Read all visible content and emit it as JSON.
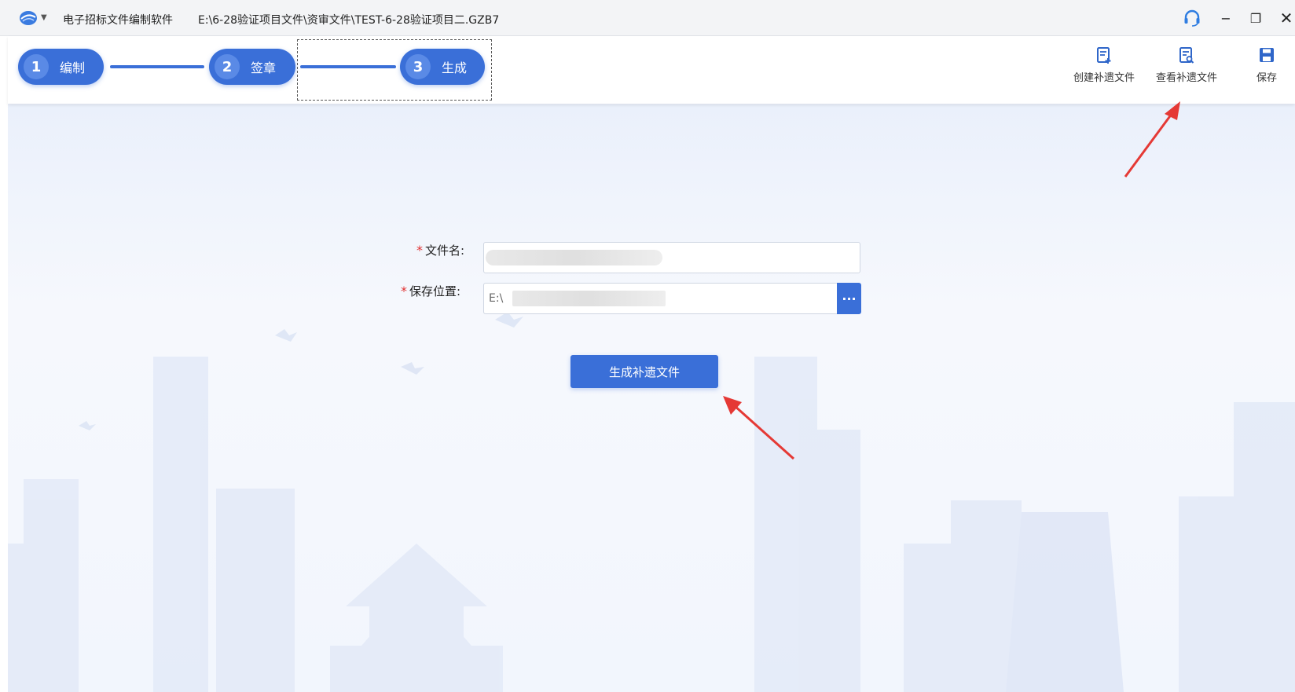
{
  "titlebar": {
    "app_name": "电子招标文件编制软件",
    "file_path": "E:\\6-28验证项目文件\\资审文件\\TEST-6-28验证项目二.GZB7",
    "minimize_glyph": "−",
    "restore_glyph": "❐",
    "close_glyph": "✕"
  },
  "steps": [
    {
      "number": "1",
      "label": "编制"
    },
    {
      "number": "2",
      "label": "签章"
    },
    {
      "number": "3",
      "label": "生成"
    }
  ],
  "toolbar": {
    "create_label": "创建补遗文件",
    "view_label": "查看补遗文件",
    "save_label": "保存"
  },
  "form": {
    "required_mark": "*",
    "file_name_label": "文件名:",
    "save_location_label": "保存位置:",
    "save_location_value": "E:\\",
    "browse_label": "···",
    "generate_button": "生成补遗文件"
  },
  "colors": {
    "accent": "#3a6fd8",
    "required": "#e03131",
    "annotation_arrow": "#e53935"
  }
}
